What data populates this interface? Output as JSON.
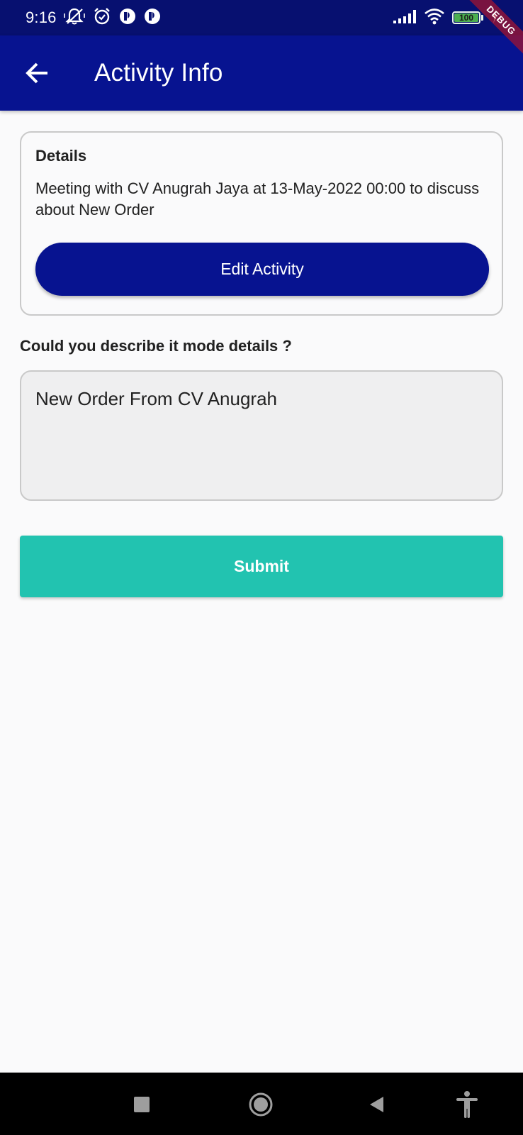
{
  "status_bar": {
    "time": "9:16",
    "battery_level": "100",
    "battery_fraction": 1.0,
    "icons": [
      "mute-notifications-icon",
      "alarm-icon",
      "app-notification-icon",
      "app-notification-icon",
      "signal-icon",
      "wifi-icon",
      "battery-icon",
      "charging-icon"
    ]
  },
  "debug_banner": "DEBUG",
  "app_bar": {
    "title": "Activity Info",
    "back_icon": "arrow-back-icon"
  },
  "details_card": {
    "title": "Details",
    "description": "Meeting with CV Anugrah Jaya at 13-May-2022 00:00 to discuss about New Order",
    "edit_button_label": "Edit Activity"
  },
  "question": {
    "label": "Could you describe it mode details ?",
    "value": "New Order From CV Anugrah"
  },
  "submit_label": "Submit",
  "nav_bar": {
    "buttons": [
      "recents-square-icon",
      "home-circle-icon",
      "back-triangle-icon",
      "accessibility-icon"
    ]
  },
  "colors": {
    "primary": "#071390",
    "status_bar": "#071070",
    "submit": "#22c3b0",
    "background": "#fafafb"
  }
}
